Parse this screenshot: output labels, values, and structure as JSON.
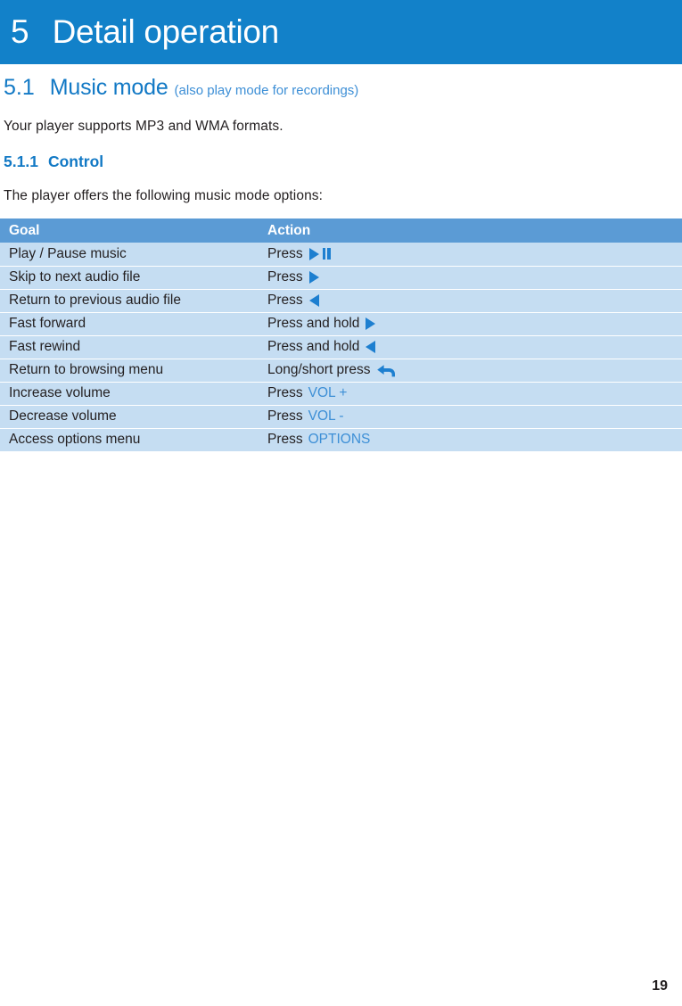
{
  "chapter": {
    "number": "5",
    "title": "Detail operation"
  },
  "section": {
    "number": "5.1",
    "title": "Music mode",
    "subtitle": "(also play mode for recordings)",
    "paragraph": "Your player supports MP3 and WMA formats."
  },
  "subsection": {
    "number": "5.1.1",
    "title": "Control",
    "intro": "The player offers the following music mode options:"
  },
  "table": {
    "headers": {
      "goal": "Goal",
      "action": "Action"
    },
    "rows": [
      {
        "goal": "Play / Pause music",
        "action_text": "Press",
        "icon": "play-pause-icon",
        "key": ""
      },
      {
        "goal": "Skip to next audio file",
        "action_text": "Press",
        "icon": "next-arrow-icon",
        "key": ""
      },
      {
        "goal": "Return to previous audio file",
        "action_text": "Press",
        "icon": "previous-arrow-icon",
        "key": ""
      },
      {
        "goal": "Fast forward",
        "action_text": "Press and hold",
        "icon": "next-arrow-icon",
        "key": ""
      },
      {
        "goal": "Fast rewind",
        "action_text": "Press and hold",
        "icon": "previous-arrow-icon",
        "key": ""
      },
      {
        "goal": "Return to browsing menu",
        "action_text": "Long/short press",
        "icon": "back-arrow-icon",
        "key": ""
      },
      {
        "goal": "Increase volume",
        "action_text": "Press",
        "icon": "",
        "key": "VOL +"
      },
      {
        "goal": "Decrease volume",
        "action_text": "Press",
        "icon": "",
        "key": "VOL -"
      },
      {
        "goal": "Access options menu",
        "action_text": "Press",
        "icon": "",
        "key": "OPTIONS"
      }
    ]
  },
  "footer": {
    "page_number": "19"
  },
  "colors": {
    "banner_blue": "#1281c9",
    "heading_blue": "#1279c5",
    "accent_blue": "#3d8fd6",
    "table_header_blue": "#5b9bd5",
    "table_row_blue": "#c5ddf2",
    "icon_blue": "#1d7fd0"
  }
}
